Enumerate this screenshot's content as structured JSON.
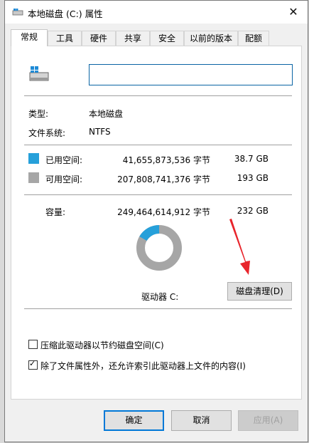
{
  "window": {
    "title": "本地磁盘 (C:) 属性",
    "close_glyph": "✕",
    "icon": "drive-icon"
  },
  "tabs": [
    {
      "label": "常规",
      "active": true
    },
    {
      "label": "工具"
    },
    {
      "label": "硬件"
    },
    {
      "label": "共享"
    },
    {
      "label": "安全"
    },
    {
      "label": "以前的版本"
    },
    {
      "label": "配额"
    }
  ],
  "general": {
    "name_value": "",
    "type_label": "类型:",
    "type_value": "本地磁盘",
    "fs_label": "文件系统:",
    "fs_value": "NTFS",
    "used_label": "已用空间:",
    "used_bytes": "41,655,873,536 字节",
    "used_size": "38.7 GB",
    "free_label": "可用空间:",
    "free_bytes": "207,808,741,376 字节",
    "free_size": "193 GB",
    "capacity_label": "容量:",
    "capacity_bytes": "249,464,614,912 字节",
    "capacity_size": "232 GB",
    "drive_label": "驱动器 C:",
    "cleanup_button": "磁盘清理(D)",
    "used_fraction": 0.167,
    "used_color": "#26a0da",
    "free_color": "#a6a6a6"
  },
  "options": {
    "compress_label": "压缩此驱动器以节约磁盘空间(C)",
    "compress_checked": false,
    "index_label": "除了文件属性外，还允许索引此驱动器上文件的内容(I)",
    "index_checked": true,
    "check_glyph": "✓"
  },
  "footer": {
    "ok": "确定",
    "cancel": "取消",
    "apply": "应用(A)",
    "apply_disabled": true
  },
  "annotation": {
    "color": "#e8242b",
    "icon": "red-arrow-annotation"
  }
}
